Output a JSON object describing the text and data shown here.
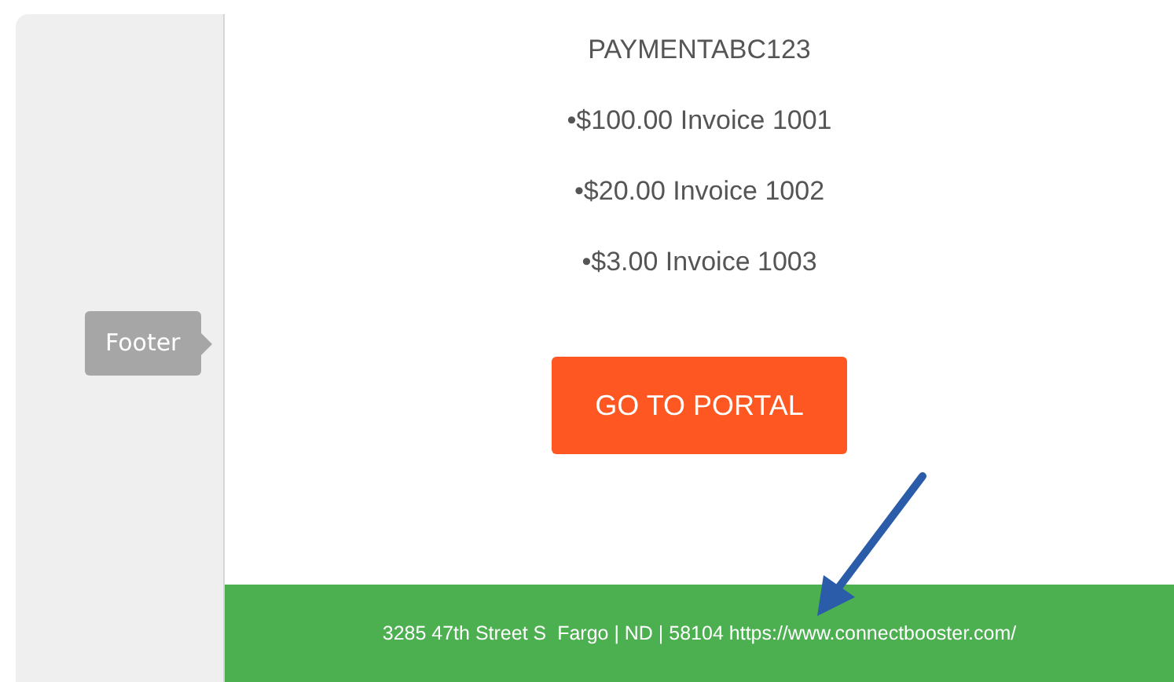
{
  "sidebar": {
    "tag": "Footer"
  },
  "email": {
    "reference": "PAYMENTABC123",
    "lines": [
      "•$100.00 Invoice 1001",
      "•$20.00 Invoice 1002",
      "•$3.00 Invoice 1003"
    ],
    "button": "GO TO PORTAL",
    "footer": "3285 47th Street S  Fargo | ND | 58104 https://www.connectbooster.com/"
  }
}
